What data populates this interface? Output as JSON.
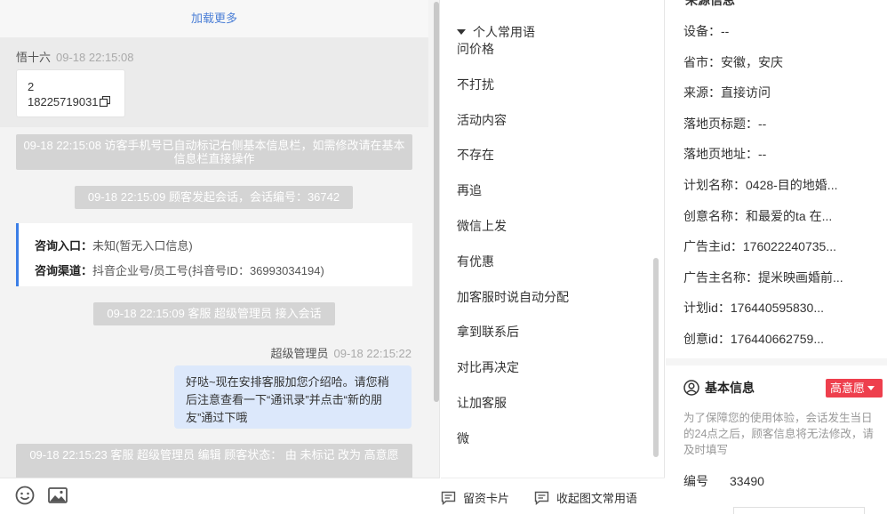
{
  "chat": {
    "load_more": "加载更多",
    "visitor_name": "悟十六",
    "visitor_time": "09-18 22:15:08",
    "card_line1": "2",
    "card_line2": "18225719031",
    "sys_msg_1": "09-18 22:15:08 访客手机号已自动标记右侧基本信息栏，如需修改请在基本信息栏直接操作",
    "sys_msg_2": "09-18 22:15:09 顾客发起会话，会话编号：36742",
    "entry_label": "咨询入口：",
    "entry_value": "未知(暂无入口信息)",
    "channel_label": "咨询渠道：",
    "channel_value": "抖音企业号/员工号(抖音号ID：36993034194)",
    "sys_msg_3": "09-18 22:15:09 客服 超级管理员 接入会话",
    "agent_name": "超级管理员",
    "agent_time": "09-18 22:15:22",
    "agent_message": "好哒~现在安排客服加您介绍哈。请您稍后注意查看一下“通讯录”并点击“新的朋友”通过下哦",
    "sys_msg_4": "09-18 22:15:23 客服 超级管理员 编辑 顾客状态： 由 未标记 改为 高意愿"
  },
  "phrases": {
    "header": "个人常用语",
    "items": [
      "问价格",
      "不打扰",
      "活动内容",
      "不存在",
      "再追",
      "微信上发",
      "有优惠",
      "加客服时说自动分配",
      "拿到联系后",
      "对比再决定",
      "让加客服",
      "微"
    ],
    "footer_card": "留资卡片",
    "footer_collapse": "收起图文常用语"
  },
  "info": {
    "top_title": "来源信息",
    "rows": [
      "设备：--",
      "省市：安徽，安庆",
      "来源：直接访问",
      "落地页标题：--",
      "落地页地址：--",
      "计划名称：0428-目的地婚...",
      "创意名称：和最爱的ta 在...",
      "广告主id：176022240735...",
      "广告主名称：提米映画婚前...",
      "计划id：176440595830...",
      "创意id：176440662759..."
    ],
    "basic_title": "基本信息",
    "intent_badge": "高意愿",
    "notice": "为了保障您的使用体验，会话发生当日的24点之后，顾客信息将无法修改，请及时填写",
    "serial_label": "编号",
    "serial_value": "33490"
  },
  "colors": {
    "accent_blue": "#3b7ee6",
    "link_blue": "#4a7ed6",
    "badge_red": "#ee3f4d",
    "agent_bubble": "#dce8fb"
  }
}
